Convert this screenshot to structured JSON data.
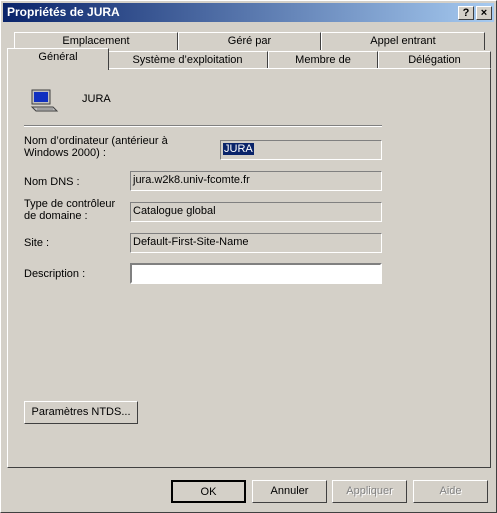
{
  "window": {
    "title": "Propriétés de JURA",
    "help_label": "?",
    "close_label": "×"
  },
  "tabs_back": [
    {
      "label": "Emplacement"
    },
    {
      "label": "Géré par"
    },
    {
      "label": "Appel entrant"
    }
  ],
  "tabs_front": [
    {
      "label": "Général",
      "active": true
    },
    {
      "label": "Système d’exploitation"
    },
    {
      "label": "Membre de"
    },
    {
      "label": "Délégation"
    }
  ],
  "header": {
    "computer_name": "JURA",
    "icon": "computer-icon"
  },
  "fields": {
    "netbios": {
      "label_line1": "Nom d’ordinateur (antérieur à",
      "label_line2": "Windows 2000) :",
      "value": "JURA"
    },
    "dns": {
      "label": "Nom DNS :",
      "value": "jura.w2k8.univ-fcomte.fr"
    },
    "dc_type": {
      "label_line1": "Type de contrôleur",
      "label_line2": "de domaine :",
      "value": "Catalogue global"
    },
    "site": {
      "label": "Site :",
      "value": "Default-First-Site-Name"
    },
    "description": {
      "label": "Description :",
      "value": ""
    }
  },
  "ntds_button": "Paramètres NTDS...",
  "footer": {
    "ok": "OK",
    "cancel": "Annuler",
    "apply": "Appliquer",
    "help": "Aide"
  }
}
